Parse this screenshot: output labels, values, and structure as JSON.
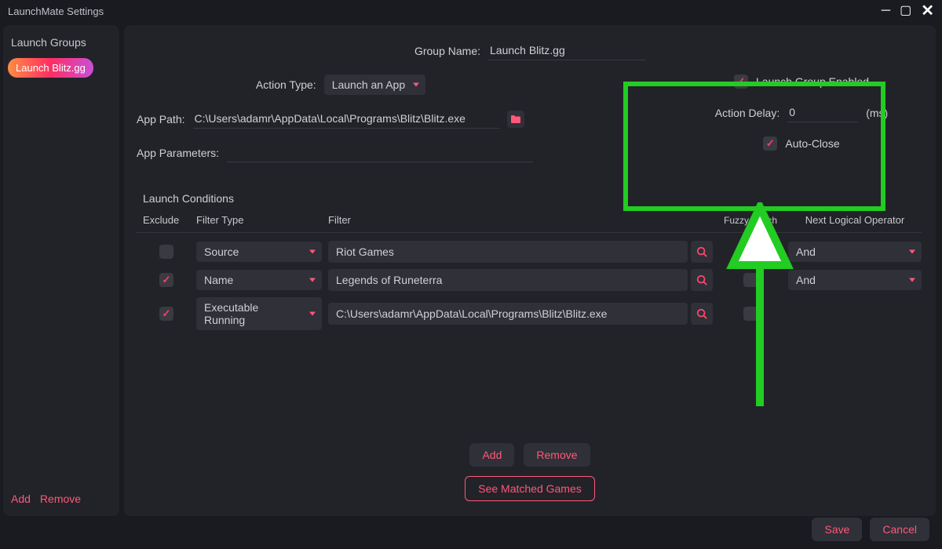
{
  "window": {
    "title": "LaunchMate Settings"
  },
  "sidebar": {
    "header": "Launch Groups",
    "items": [
      {
        "label": "Launch Blitz.gg"
      }
    ],
    "add": "Add",
    "remove": "Remove"
  },
  "form": {
    "groupNameLabel": "Group Name:",
    "groupNameValue": "Launch Blitz.gg",
    "actionTypeLabel": "Action Type:",
    "actionTypeValue": "Launch an App",
    "appPathLabel": "App Path:",
    "appPathValue": "C:\\Users\\adamr\\AppData\\Local\\Programs\\Blitz\\Blitz.exe",
    "appParamsLabel": "App Parameters:",
    "appParamsValue": "",
    "enabledLabel": "Launch Group Enabled",
    "actionDelayLabel": "Action Delay:",
    "actionDelayValue": "0",
    "actionDelayUnit": "(ms)",
    "autoCloseLabel": "Auto-Close"
  },
  "conditions": {
    "title": "Launch Conditions",
    "columns": {
      "exclude": "Exclude",
      "filterType": "Filter Type",
      "filter": "Filter",
      "fuzzy": "Fuzzy Match",
      "next": "Next Logical Operator"
    },
    "rows": [
      {
        "excluded": false,
        "filterType": "Source",
        "filter": "Riot Games",
        "fuzzy": false,
        "op": "And"
      },
      {
        "excluded": true,
        "filterType": "Name",
        "filter": "Legends of Runeterra",
        "fuzzy": false,
        "op": "And"
      },
      {
        "excluded": true,
        "filterType": "Executable Running",
        "filter": "C:\\Users\\adamr\\AppData\\Local\\Programs\\Blitz\\Blitz.exe",
        "fuzzy": false,
        "op": ""
      }
    ],
    "add": "Add",
    "remove": "Remove",
    "seeMatched": "See Matched Games"
  },
  "footer": {
    "save": "Save",
    "cancel": "Cancel"
  }
}
